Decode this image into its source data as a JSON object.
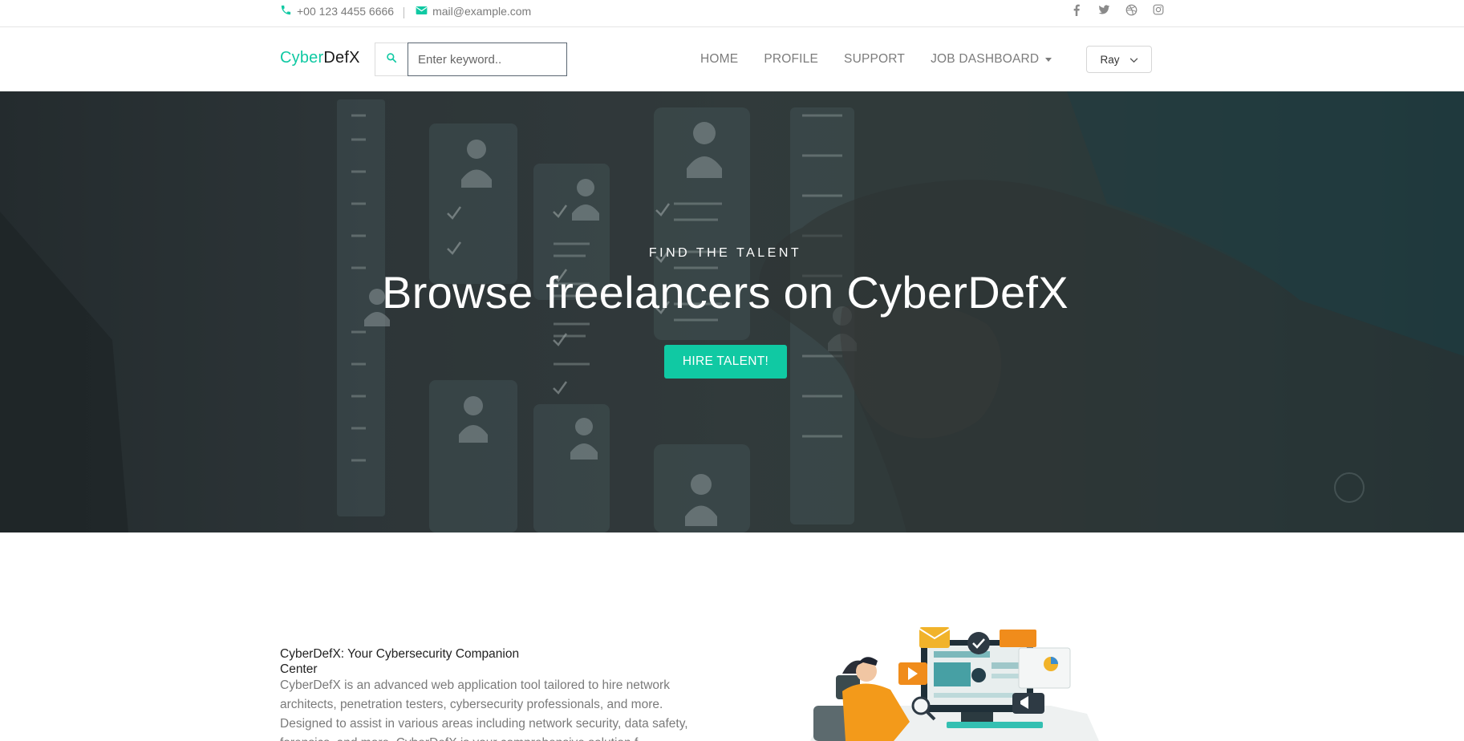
{
  "topbar": {
    "phone": "+00 123 4455 6666",
    "email": "mail@example.com",
    "social_icons": [
      "facebook-icon",
      "twitter-icon",
      "dribbble-icon",
      "instagram-icon"
    ]
  },
  "navbar": {
    "brand_part1": "Cyber",
    "brand_part2": "DefX",
    "search_placeholder": "Enter keyword..",
    "menu": [
      {
        "label": "HOME"
      },
      {
        "label": "PROFILE"
      },
      {
        "label": "SUPPORT"
      },
      {
        "label": "JOB DASHBOARD"
      }
    ],
    "user_label": "Ray"
  },
  "hero": {
    "kicker": "FIND THE TALENT",
    "title": "Browse freelancers on CyberDefX",
    "cta_label": "HIRE TALENT!"
  },
  "about": {
    "title": "CyberDefX: Your Cybersecurity Companion Center",
    "text": "CyberDefX is an advanced web application tool tailored to hire network architects, penetration testers, cybersecurity professionals, and more. Designed to assist in various areas including network security, data safety, forensics, and more, CyberDefX is your comprehensive solution f"
  },
  "colors": {
    "accent": "#10c9a3",
    "brand_dark": "#1a1a1a",
    "muted_text": "#7a7a7a"
  }
}
